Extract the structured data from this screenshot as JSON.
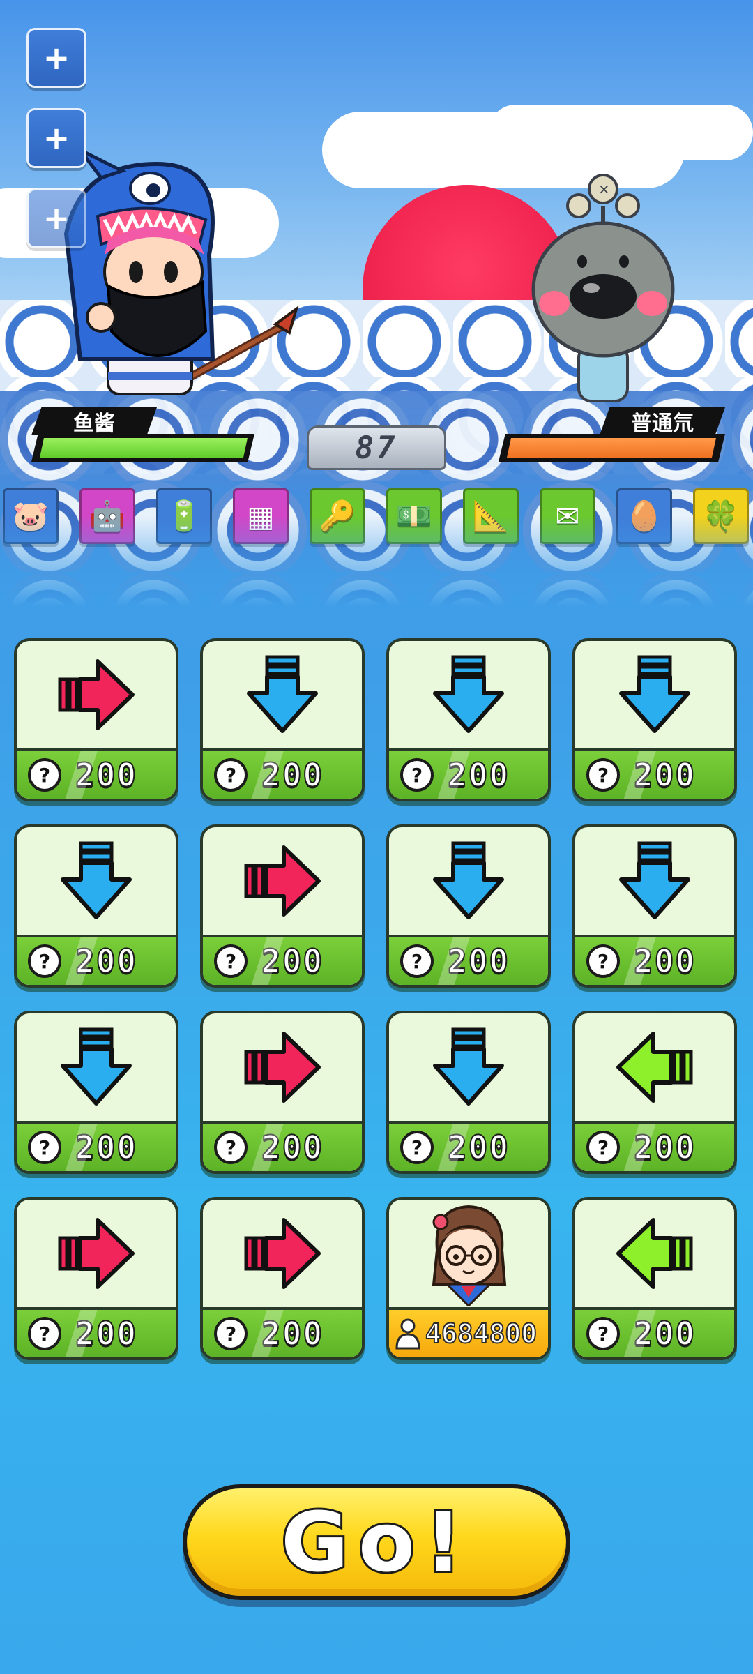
{
  "battle": {
    "player_name": "鱼酱",
    "enemy_name": "普通氘",
    "round": "87",
    "player_hp_fraction": 1.0,
    "enemy_hp_fraction": 1.0
  },
  "side_buttons": [
    "plus-icon",
    "plus-icon",
    "plus-icon"
  ],
  "items": [
    {
      "name": "piggy-bank-icon",
      "glyph": "🐷",
      "color": "#3f7ed9"
    },
    {
      "name": "robot-icon",
      "glyph": "🤖",
      "color": "#d147c8"
    },
    {
      "name": "battery-icon",
      "glyph": "🔋",
      "color": "#3f7ed9"
    },
    {
      "name": "calculator-icon",
      "glyph": "▦",
      "color": "#d147c8"
    },
    {
      "name": "key-icon",
      "glyph": "🔑",
      "color": "#6bc82e"
    },
    {
      "name": "cash-icon",
      "glyph": "💵",
      "color": "#6bc82e"
    },
    {
      "name": "ruler-icon",
      "glyph": "📐",
      "color": "#6bc82e"
    },
    {
      "name": "letter-icon",
      "glyph": "✉",
      "color": "#6bc82e"
    },
    {
      "name": "nest-icon",
      "glyph": "🥚",
      "color": "#3f7ed9"
    },
    {
      "name": "clover-icon",
      "glyph": "🍀",
      "color": "#f2d21c"
    }
  ],
  "cards": [
    {
      "arrow": "right",
      "price": "200"
    },
    {
      "arrow": "down",
      "price": "200"
    },
    {
      "arrow": "down",
      "price": "200"
    },
    {
      "arrow": "down",
      "price": "200"
    },
    {
      "arrow": "down",
      "price": "200"
    },
    {
      "arrow": "right",
      "price": "200"
    },
    {
      "arrow": "down",
      "price": "200"
    },
    {
      "arrow": "down",
      "price": "200"
    },
    {
      "arrow": "down",
      "price": "200"
    },
    {
      "arrow": "right",
      "price": "200"
    },
    {
      "arrow": "down",
      "price": "200"
    },
    {
      "arrow": "left",
      "price": "200"
    },
    {
      "arrow": "right",
      "price": "200"
    },
    {
      "arrow": "right",
      "price": "200"
    },
    {
      "arrow": "avatar",
      "score": "4684800"
    },
    {
      "arrow": "left",
      "price": "200"
    }
  ],
  "go_button": {
    "label": "Go!"
  },
  "colors": {
    "arrow_right": "#f2255a",
    "arrow_down": "#2aaef0",
    "arrow_left": "#8ef02a",
    "card_face": "#eaf9dc",
    "card_foot": "#6bc82e",
    "card_foot_gold": "#f9b812"
  }
}
